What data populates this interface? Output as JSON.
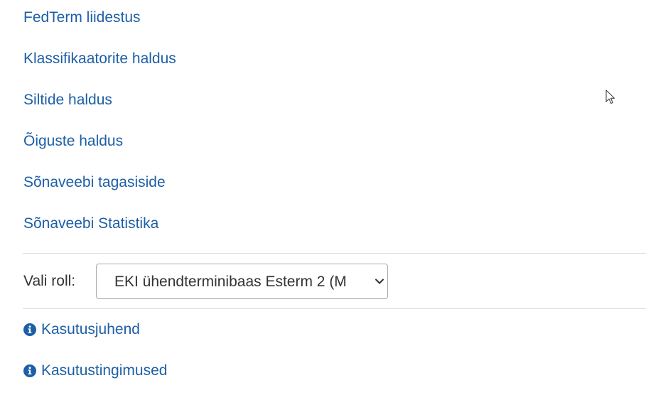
{
  "menu": {
    "items": [
      {
        "label": "FedTerm liidestus"
      },
      {
        "label": "Klassifikaatorite haldus"
      },
      {
        "label": "Siltide haldus"
      },
      {
        "label": "Õiguste haldus"
      },
      {
        "label": "Sõnaveebi tagasiside"
      },
      {
        "label": "Sõnaveebi Statistika"
      }
    ]
  },
  "role": {
    "label": "Vali roll:",
    "selected": "EKI ühendterminibaas Esterm 2 (M"
  },
  "help": {
    "items": [
      {
        "label": "Kasutusjuhend",
        "icon": "info-circle-icon"
      },
      {
        "label": "Kasutustingimused",
        "icon": "info-circle-icon"
      }
    ]
  },
  "colors": {
    "link": "#1d5fa6",
    "text": "#333333",
    "divider": "#dcdcdc"
  }
}
